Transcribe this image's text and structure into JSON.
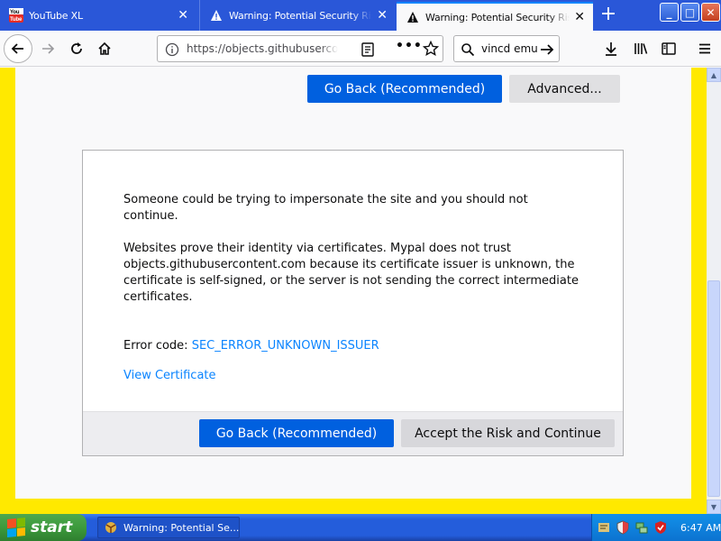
{
  "browser": {
    "tabs": [
      {
        "label": "YouTube XL",
        "icon": "youtube-icon",
        "active": false
      },
      {
        "label": "Warning: Potential Security Risk Ahead",
        "icon": "warning-icon",
        "active": false
      },
      {
        "label": "Warning: Potential Security Risk Ahead",
        "icon": "warning-icon",
        "active": true
      }
    ],
    "new_tab_label": "+",
    "window_controls": {
      "minimize": "_",
      "maximize": "□",
      "close": "✕"
    },
    "url": "https://objects.githubusercontent.com",
    "search_text": "vincd emu"
  },
  "page": {
    "top_buttons": {
      "go_back": "Go Back (Recommended)",
      "advanced": "Advanced..."
    },
    "intro": "Someone could be trying to impersonate the site and you should not continue.",
    "detail": "Websites prove their identity via certificates. Mypal does not trust objects.githubusercontent.com because its certificate issuer is unknown, the certificate is self-signed, or the server is not sending the correct intermediate certificates.",
    "error_label": "Error code: ",
    "error_code": "SEC_ERROR_UNKNOWN_ISSUER",
    "view_certificate": "View Certificate",
    "bottom_buttons": {
      "go_back": "Go Back (Recommended)",
      "accept": "Accept the Risk and Continue"
    }
  },
  "taskbar": {
    "start_label": "start",
    "task_item": "Warning: Potential Se...",
    "clock": "6:47 AM"
  },
  "colors": {
    "accent": "#0060df",
    "link": "#0a84ff",
    "page_border": "#ffe900",
    "tabstrip": "#2a57d8"
  }
}
